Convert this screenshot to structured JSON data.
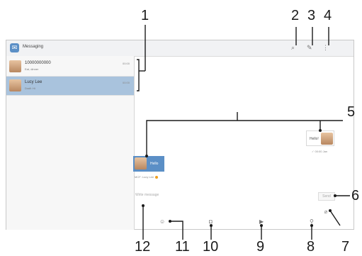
{
  "app": {
    "title": "Messaging"
  },
  "conversations": [
    {
      "name": "10000000000",
      "preview": "Eat, dinner",
      "time": "00:00"
    },
    {
      "name": "Lucy Lee",
      "preview": "Draft: Hi",
      "time": "00:00"
    }
  ],
  "thread": {
    "outgoing_text": "Hello!",
    "outgoing_status": "✓ 00:00 Jan",
    "incoming_text": "Hello",
    "incoming_status": "MCF: Lucy Lee"
  },
  "compose": {
    "placeholder": "Write message",
    "send_label": "Send"
  },
  "callouts": [
    "1",
    "2",
    "3",
    "4",
    "5",
    "6",
    "7",
    "8",
    "9",
    "10",
    "11",
    "12"
  ],
  "icons": {
    "app": "messaging-icon",
    "search": "search-icon",
    "new_message": "new-message-icon",
    "menu": "overflow-menu-icon",
    "attach": "attach-icon",
    "location": "location-icon",
    "video": "video-icon",
    "camera": "camera-icon",
    "emoji": "emoji-icon"
  },
  "colors": {
    "accent": "#5b8fc6",
    "selected_row": "#a9c3dd"
  }
}
